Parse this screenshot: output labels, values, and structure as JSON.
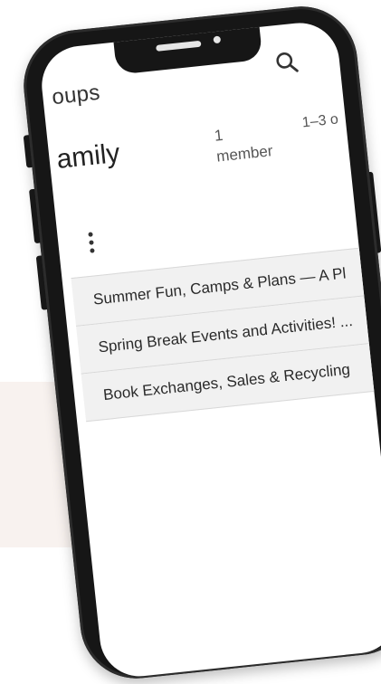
{
  "header": {
    "title": "oups",
    "search_icon": "search-icon",
    "more_icon": "more-icon"
  },
  "group": {
    "name": "amily",
    "members_count": "1",
    "members_label": "member",
    "activity": "1–3 o"
  },
  "menu_icon": "more-vertical-icon",
  "topics": [
    "Summer Fun, Camps & Plans — A Pl",
    "Spring Break Events and Activities! ...",
    "Book Exchanges, Sales & Recycling"
  ],
  "colors": {
    "frame": "#161616",
    "screen": "#ffffff",
    "row_bg": "#f1f1f1",
    "band_bg": "#f8f2ef"
  }
}
